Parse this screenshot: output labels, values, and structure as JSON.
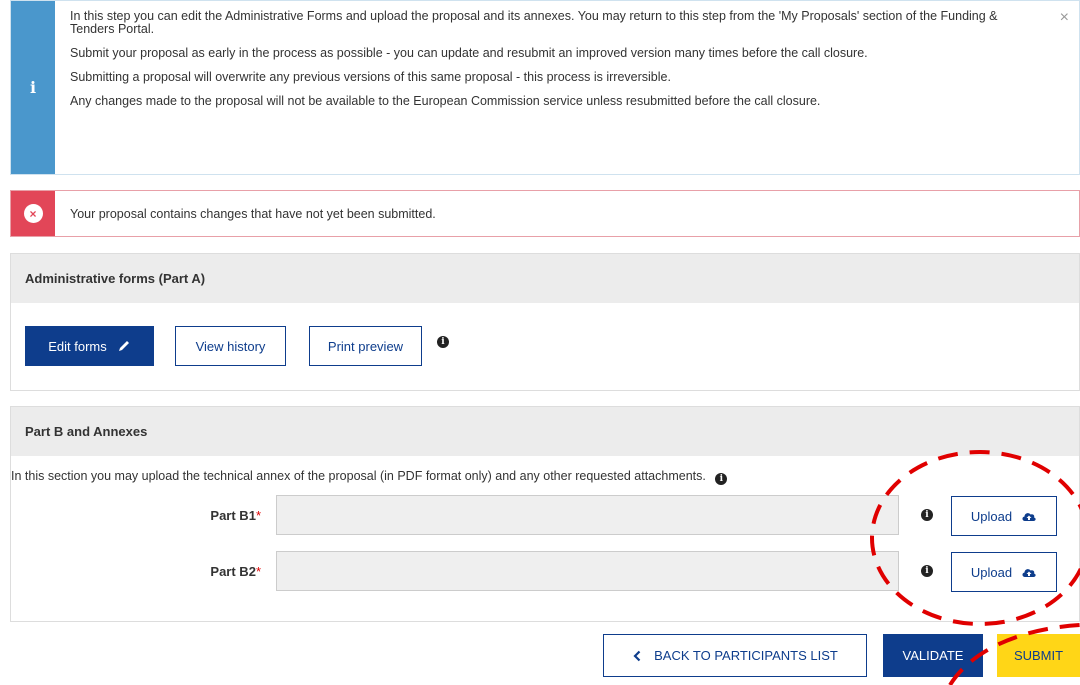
{
  "info": {
    "icon": "info-icon",
    "paragraphs": [
      "In this step you can edit the Administrative Forms and upload the proposal and its annexes. You may return to this step from the 'My Proposals' section of the Funding & Tenders Portal.",
      "Submit your proposal as early in the process as possible - you can update and resubmit an improved version many times before the call closure.",
      "Submitting a proposal will overwrite any previous versions of this same proposal - this process is irreversible.",
      "Any changes made to the proposal will not be available to the European Commission service unless resubmitted before the call closure."
    ],
    "close": "×"
  },
  "error": {
    "icon_glyph": "×",
    "message": "Your proposal contains changes that have not yet been submitted."
  },
  "part_a": {
    "title": "Administrative forms (Part A)",
    "edit_label": "Edit forms",
    "history_label": "View history",
    "print_label": "Print preview"
  },
  "part_b": {
    "title": "Part B and Annexes",
    "description": "In this section you may upload the technical annex of the proposal (in PDF format only) and any other requested attachments.",
    "fields": [
      {
        "label": "Part B1",
        "upload_label": "Upload"
      },
      {
        "label": "Part B2",
        "upload_label": "Upload"
      }
    ]
  },
  "footer": {
    "back_label": "BACK TO PARTICIPANTS LIST",
    "validate_label": "VALIDATE",
    "submit_label": "SUBMIT"
  },
  "colors": {
    "primary": "#0e3d8c",
    "info": "#4a97cc",
    "error": "#e24658",
    "submit": "#ffd617",
    "annotation": "#e00000"
  }
}
